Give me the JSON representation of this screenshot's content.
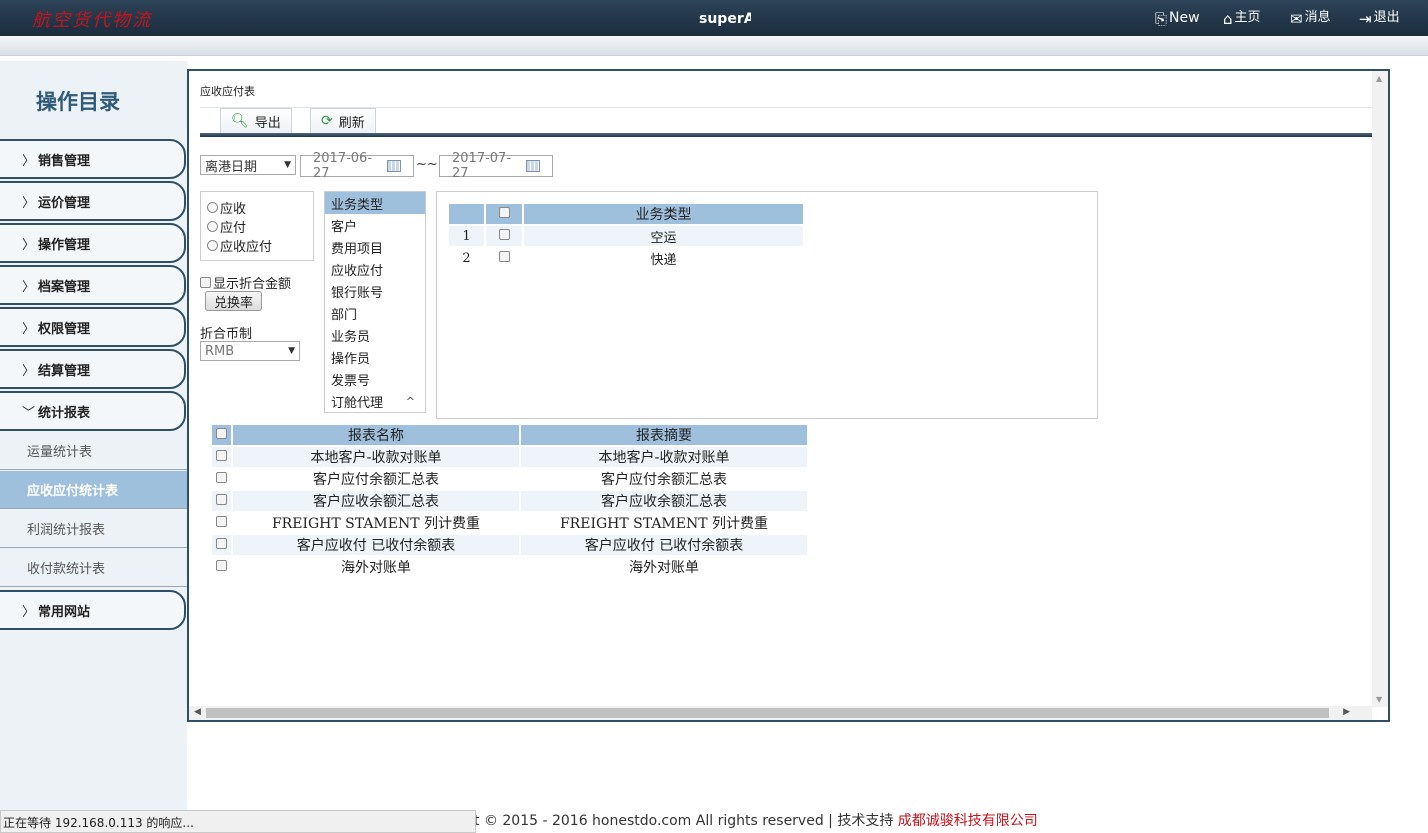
{
  "header": {
    "logo": "航空货代物流",
    "app_title": "superA(",
    "links": [
      {
        "icon": "new-icon",
        "label": "New"
      },
      {
        "icon": "home-icon",
        "label": "主页"
      },
      {
        "icon": "mail-icon",
        "label": "消息"
      },
      {
        "icon": "logout-icon",
        "label": "退出"
      }
    ]
  },
  "sidebar": {
    "title": "操作目录",
    "menu": [
      {
        "label": "销售管理",
        "expanded": false
      },
      {
        "label": "运价管理",
        "expanded": false
      },
      {
        "label": "操作管理",
        "expanded": false
      },
      {
        "label": "档案管理",
        "expanded": false
      },
      {
        "label": "权限管理",
        "expanded": false
      },
      {
        "label": "结算管理",
        "expanded": false
      },
      {
        "label": "统计报表",
        "expanded": true
      },
      {
        "label": "常用网站",
        "expanded": false
      }
    ],
    "submenu": [
      {
        "label": "运量统计表",
        "active": false
      },
      {
        "label": "应收应付统计表",
        "active": true
      },
      {
        "label": "利润统计报表",
        "active": false
      },
      {
        "label": "收付款统计表",
        "active": false
      }
    ]
  },
  "main": {
    "title": "应收应付表",
    "toolbar": {
      "export_label": "导出",
      "refresh_label": "刷新"
    },
    "date_filter": {
      "field": "离港日期",
      "from": "2017-06-27",
      "to": "2017-07-27",
      "separator": "~~"
    },
    "radio_options": [
      "应收",
      "应付",
      "应收应付"
    ],
    "show_fold_label": "显示折合金额",
    "exchange_button": "兑换率",
    "currency_label": "折合币制",
    "currency_value": "RMB",
    "type_list": [
      "业务类型",
      "客户",
      "费用项目",
      "应收应付",
      "银行账号",
      "部门",
      "业务员",
      "操作员",
      "发票号",
      "订舱代理"
    ],
    "biz_table": {
      "header": "业务类型",
      "rows": [
        {
          "num": "1",
          "name": "空运"
        },
        {
          "num": "2",
          "name": "快递"
        }
      ]
    },
    "report_table": {
      "headers": [
        "报表名称",
        "报表摘要"
      ],
      "rows": [
        {
          "name": "本地客户-收款对账单",
          "summary": "本地客户-收款对账单"
        },
        {
          "name": "客户应付余额汇总表",
          "summary": "客户应付余额汇总表"
        },
        {
          "name": "客户应收余额汇总表",
          "summary": "客户应收余额汇总表"
        },
        {
          "name": "FREIGHT STAMENT 列计费重",
          "summary": "FREIGHT STAMENT 列计费重"
        },
        {
          "name": "客户应收付 已收付余额表",
          "summary": "客户应收付 已收付余额表"
        },
        {
          "name": "海外对账单",
          "summary": "海外对账单"
        }
      ]
    }
  },
  "footer": {
    "copyright": "t © 2015 - 2016 honestdo.com All rights reserved | 技术支持 ",
    "company": "成都诚骏科技有限公司"
  },
  "status": "正在等待 192.168.0.113 的响应..."
}
